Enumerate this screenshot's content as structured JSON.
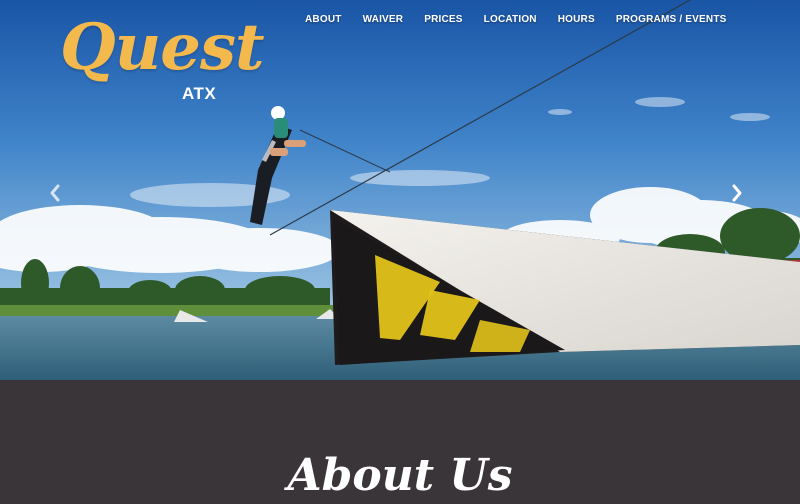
{
  "brand": {
    "name": "Quest",
    "location": "ATX",
    "color": "#f4b94d"
  },
  "nav": {
    "items": [
      {
        "label": "ABOUT"
      },
      {
        "label": "WAIVER"
      },
      {
        "label": "PRICES"
      },
      {
        "label": "LOCATION"
      },
      {
        "label": "HOURS"
      },
      {
        "label": "PROGRAMS / EVENTS"
      }
    ]
  },
  "hero": {
    "prev_icon": "chevron-left-icon",
    "next_icon": "chevron-right-icon",
    "ramp_graphic_text": "KU"
  },
  "about": {
    "title": "About Us"
  },
  "colors": {
    "sky_top": "#1f62b3",
    "sky_bottom": "#8fbde0",
    "water": "#3f6f8a",
    "section_bg": "#3a3538",
    "ramp_surface": "#e9e6e1",
    "ramp_accent": "#e3c21a"
  }
}
